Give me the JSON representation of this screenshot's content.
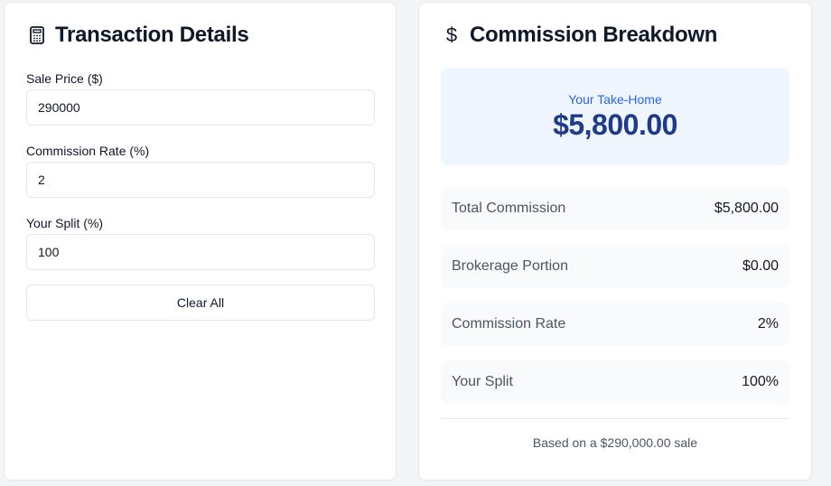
{
  "transaction": {
    "title": "Transaction Details",
    "icon": "calculator-icon",
    "fields": {
      "sale_price": {
        "label": "Sale Price ($)",
        "value": "290000"
      },
      "commission_rate": {
        "label": "Commission Rate (%)",
        "value": "2"
      },
      "split": {
        "label": "Your Split (%)",
        "value": "100"
      }
    },
    "clear_label": "Clear All"
  },
  "breakdown": {
    "title": "Commission Breakdown",
    "icon": "dollar-sign-icon",
    "take_home_label": "Your Take-Home",
    "take_home_value": "$5,800.00",
    "rows": [
      {
        "label": "Total Commission",
        "value": "$5,800.00"
      },
      {
        "label": "Brokerage Portion",
        "value": "$0.00"
      },
      {
        "label": "Commission Rate",
        "value": "2%"
      },
      {
        "label": "Your Split",
        "value": "100%"
      }
    ],
    "footnote": "Based on a $290,000.00 sale"
  },
  "colors": {
    "accent": "#2563eb",
    "take_home_bg": "#eff6ff",
    "take_home_text": "#1e3a8a"
  }
}
